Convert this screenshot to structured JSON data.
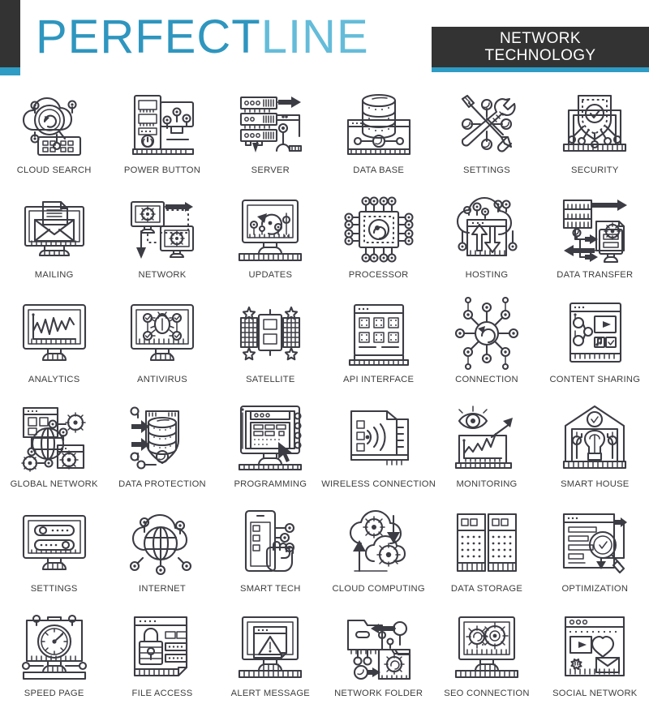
{
  "header": {
    "brand_primary": "PERFECT",
    "brand_secondary": "LINE",
    "tag_line1": "NETWORK",
    "tag_line2": "TECHNOLOGY",
    "colors": {
      "accent_blue": "#2e96bf",
      "accent_blue_light": "#64bcd9",
      "bar_blue": "#2e9cc4",
      "dark": "#333333",
      "icon_stroke": "#3c3c44",
      "caption": "#3d3d3d"
    }
  },
  "grid": {
    "columns": 6,
    "rows": 6,
    "items": [
      {
        "label": "CLOUD SEARCH",
        "icon": "cloud-search-icon"
      },
      {
        "label": "POWER BUTTON",
        "icon": "power-button-icon"
      },
      {
        "label": "SERVER",
        "icon": "server-icon"
      },
      {
        "label": "DATA BASE",
        "icon": "data-base-icon"
      },
      {
        "label": "SETTINGS",
        "icon": "settings-tools-icon"
      },
      {
        "label": "SECURITY",
        "icon": "security-shield-icon"
      },
      {
        "label": "MAILING",
        "icon": "mailing-icon"
      },
      {
        "label": "NETWORK",
        "icon": "network-icon"
      },
      {
        "label": "UPDATES",
        "icon": "updates-icon"
      },
      {
        "label": "PROCESSOR",
        "icon": "processor-icon"
      },
      {
        "label": "HOSTING",
        "icon": "hosting-icon"
      },
      {
        "label": "DATA TRANSFER",
        "icon": "data-transfer-icon"
      },
      {
        "label": "ANALYTICS",
        "icon": "analytics-icon"
      },
      {
        "label": "ANTIVIRUS",
        "icon": "antivirus-icon"
      },
      {
        "label": "SATELLITE",
        "icon": "satellite-icon"
      },
      {
        "label": "API INTERFACE",
        "icon": "api-interface-icon"
      },
      {
        "label": "CONNECTION",
        "icon": "connection-icon"
      },
      {
        "label": "CONTENT SHARING",
        "icon": "content-sharing-icon"
      },
      {
        "label": "GLOBAL NETWORK",
        "icon": "global-network-icon"
      },
      {
        "label": "DATA PROTECTION",
        "icon": "data-protection-icon"
      },
      {
        "label": "PROGRAMMING",
        "icon": "programming-icon"
      },
      {
        "label": "WIRELESS CONNECTION",
        "icon": "wireless-connection-icon"
      },
      {
        "label": "MONITORING",
        "icon": "monitoring-icon"
      },
      {
        "label": "SMART HOUSE",
        "icon": "smart-house-icon"
      },
      {
        "label": "SETTINGS",
        "icon": "settings-panel-icon"
      },
      {
        "label": "INTERNET",
        "icon": "internet-icon"
      },
      {
        "label": "SMART TECH",
        "icon": "smart-tech-icon"
      },
      {
        "label": "CLOUD COMPUTING",
        "icon": "cloud-computing-icon"
      },
      {
        "label": "DATA STORAGE",
        "icon": "data-storage-icon"
      },
      {
        "label": "OPTIMIZATION",
        "icon": "optimization-icon"
      },
      {
        "label": "SPEED PAGE",
        "icon": "speed-page-icon"
      },
      {
        "label": "FILE ACCESS",
        "icon": "file-access-icon"
      },
      {
        "label": "ALERT MESSAGE",
        "icon": "alert-message-icon"
      },
      {
        "label": "NETWORK FOLDER",
        "icon": "network-folder-icon"
      },
      {
        "label": "SEO CONNECTION",
        "icon": "seo-connection-icon"
      },
      {
        "label": "SOCIAL NETWORK",
        "icon": "social-network-icon"
      }
    ]
  }
}
